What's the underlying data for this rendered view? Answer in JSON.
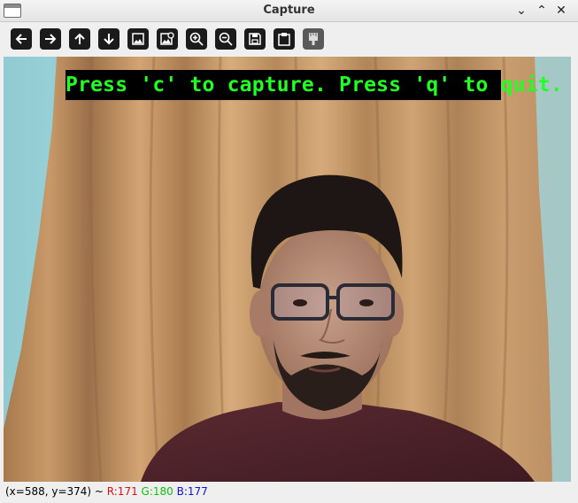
{
  "window": {
    "title": "Capture",
    "controls": [
      "⌄",
      "⌃",
      "✕"
    ]
  },
  "toolbar": {
    "buttons": [
      {
        "name": "pan-left-button",
        "icon": "arrow-left-icon"
      },
      {
        "name": "pan-right-button",
        "icon": "arrow-right-icon"
      },
      {
        "name": "pan-up-button",
        "icon": "arrow-up-icon"
      },
      {
        "name": "pan-down-button",
        "icon": "arrow-down-icon"
      },
      {
        "name": "zoom-original-button",
        "icon": "image-icon"
      },
      {
        "name": "zoom-fit-button",
        "icon": "image-zoom-icon"
      },
      {
        "name": "zoom-in-button",
        "icon": "zoom-in-icon"
      },
      {
        "name": "zoom-out-button",
        "icon": "zoom-out-icon"
      },
      {
        "name": "save-button",
        "icon": "save-icon"
      },
      {
        "name": "copy-to-clipboard-button",
        "icon": "clipboard-icon"
      },
      {
        "name": "properties-button",
        "icon": "paintbrush-icon"
      }
    ]
  },
  "image": {
    "overlay_text": "Press 'c' to capture. Press 'q' to quit.",
    "overlay_text_color": "#22ff22",
    "overlay_bg_color": "#000000"
  },
  "status": {
    "coords": "(x=588, y=374) ~ ",
    "r": "R:171",
    "g": "G:180",
    "b": "B:177"
  }
}
